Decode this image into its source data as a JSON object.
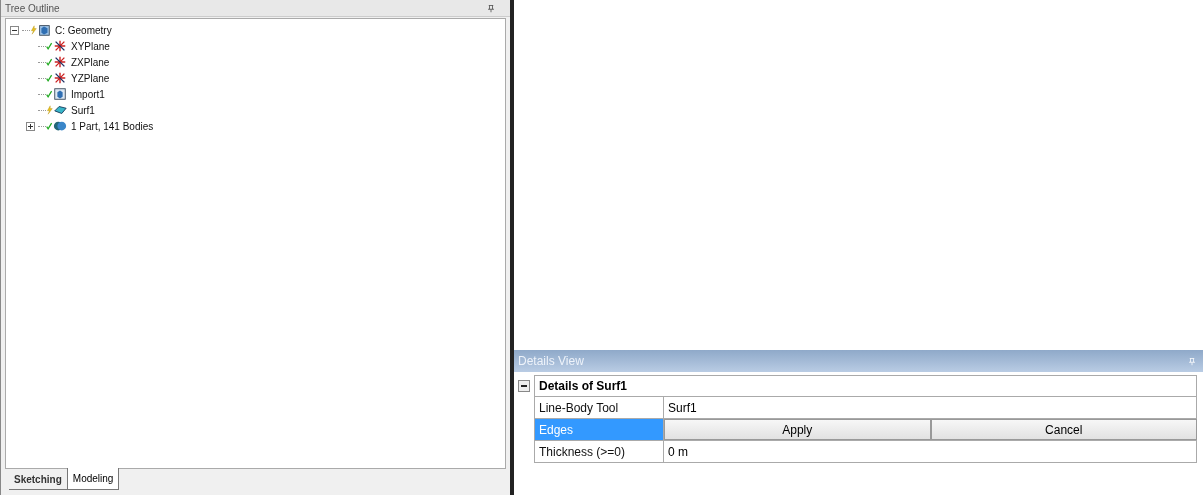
{
  "tree_outline": {
    "title": "Tree Outline",
    "items": [
      {
        "label": "C: Geometry",
        "kind": "geometry",
        "up_to_date": false,
        "expanded": true,
        "children": [
          {
            "label": "XYPlane",
            "kind": "plane",
            "up_to_date": true
          },
          {
            "label": "ZXPlane",
            "kind": "plane",
            "up_to_date": true
          },
          {
            "label": "YZPlane",
            "kind": "plane",
            "up_to_date": true
          },
          {
            "label": "Import1",
            "kind": "import",
            "up_to_date": true
          },
          {
            "label": "Surf1",
            "kind": "surface",
            "up_to_date": false
          },
          {
            "label": "1 Part, 141 Bodies",
            "kind": "part",
            "up_to_date": true,
            "expanded": false
          }
        ]
      }
    ]
  },
  "tabs": [
    {
      "label": "Sketching",
      "selected": false
    },
    {
      "label": "Modeling",
      "selected": true
    }
  ],
  "details_view": {
    "title": "Details View",
    "rows": [
      {
        "kind": "header",
        "label": "Details of Surf1",
        "expanded": true
      },
      {
        "kind": "property",
        "label": "Line-Body Tool",
        "value": "Surf1",
        "selected": false
      },
      {
        "kind": "selection",
        "label": "Edges",
        "buttons": [
          "Apply",
          "Cancel"
        ],
        "selected": true
      },
      {
        "kind": "property",
        "label": "Thickness (>=0)",
        "value": "0 m",
        "selected": false
      }
    ]
  }
}
